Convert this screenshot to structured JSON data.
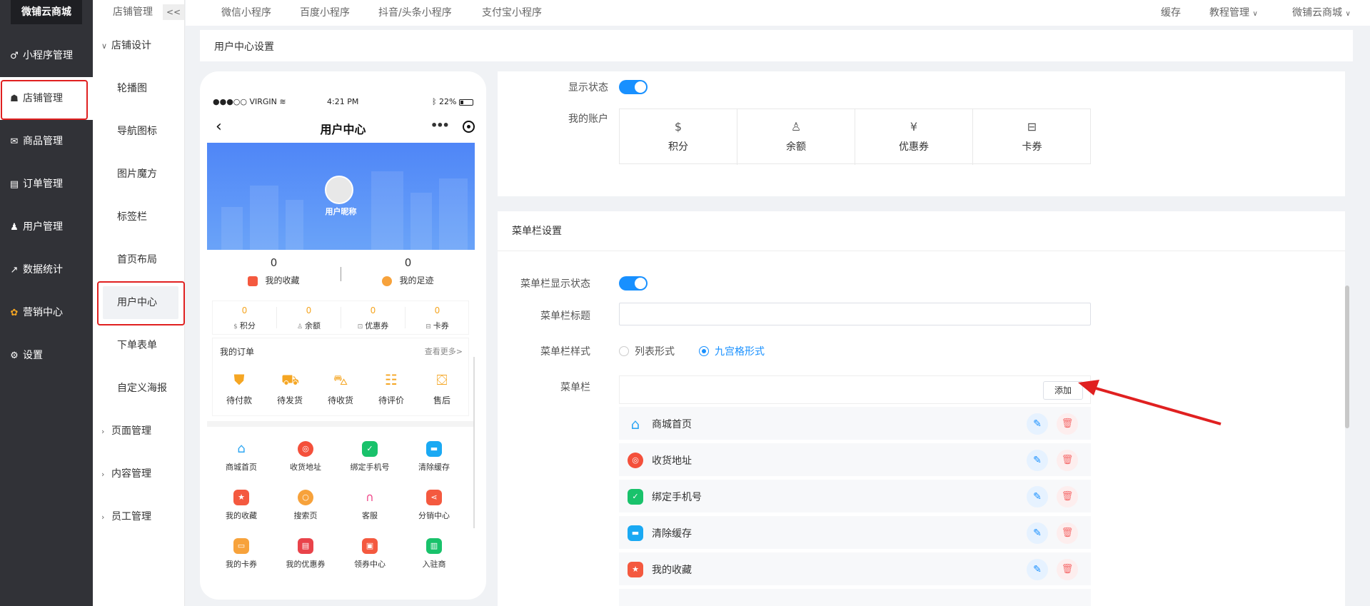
{
  "app": {
    "logo": "微铺云商城",
    "back_glyph": "<<"
  },
  "left_nav": [
    {
      "label": "小程序管理",
      "icon": "link-icon"
    },
    {
      "label": "店铺管理",
      "icon": "store-icon"
    },
    {
      "label": "商品管理",
      "icon": "bag-icon"
    },
    {
      "label": "订单管理",
      "icon": "order-icon"
    },
    {
      "label": "用户管理",
      "icon": "user-icon"
    },
    {
      "label": "数据统计",
      "icon": "chart-icon"
    },
    {
      "label": "营销中心",
      "icon": "marketing-icon"
    },
    {
      "label": "设置",
      "icon": "gear-icon"
    }
  ],
  "sub_nav": {
    "header": "店铺管理",
    "group_store_design": "店铺设计",
    "items": [
      "轮播图",
      "导航图标",
      "图片魔方",
      "标签栏",
      "首页布局",
      "用户中心",
      "下单表单",
      "自定义海报"
    ],
    "groups": [
      "页面管理",
      "内容管理",
      "员工管理"
    ]
  },
  "topbar": {
    "tabs": [
      "微信小程序",
      "百度小程序",
      "抖音/头条小程序",
      "支付宝小程序"
    ],
    "cache": "缓存",
    "tutorial": "教程管理",
    "account": "微铺云商城"
  },
  "panel_title": "用户中心设置",
  "phone": {
    "carrier": "●●●○○ VIRGIN",
    "time": "4:21 PM",
    "battery": "22%",
    "title": "用户中心",
    "nickname": "用户昵称",
    "fav_count": "0",
    "fav_label": "我的收藏",
    "foot_count": "0",
    "foot_label": "我的足迹",
    "accounts": [
      {
        "value": "0",
        "label": "积分"
      },
      {
        "value": "0",
        "label": "余额"
      },
      {
        "value": "0",
        "label": "优惠券"
      },
      {
        "value": "0",
        "label": "卡券"
      }
    ],
    "orders_title": "我的订单",
    "orders_more": "查看更多>",
    "orders": [
      "待付款",
      "待发货",
      "待收货",
      "待评价",
      "售后"
    ],
    "grid": [
      {
        "label": "商城首页",
        "color": "#ffffff"
      },
      {
        "label": "收货地址",
        "color": "#f4503b"
      },
      {
        "label": "绑定手机号",
        "color": "#19c26b"
      },
      {
        "label": "清除缓存",
        "color": "#1aa9f3"
      },
      {
        "label": "我的收藏",
        "color": "#f4593f"
      },
      {
        "label": "搜索页",
        "color": "#f7a23b"
      },
      {
        "label": "客服",
        "color": "#f0488a"
      },
      {
        "label": "分销中心",
        "color": "#f4593f"
      },
      {
        "label": "我的卡券",
        "color": "#f7a23b"
      },
      {
        "label": "我的优惠券",
        "color": "#e9434a"
      },
      {
        "label": "领券中心",
        "color": "#f4593f"
      },
      {
        "label": "入驻商",
        "color": "#19c26b"
      }
    ]
  },
  "settings": {
    "display_status_label": "显示状态",
    "my_account_label": "我的账户",
    "account_items": [
      "积分",
      "余额",
      "优惠券",
      "卡券"
    ],
    "menu_section_title": "菜单栏设置",
    "menu_display_label": "菜单栏显示状态",
    "menu_title_label": "菜单栏标题",
    "menu_title_value": "",
    "menu_style_label": "菜单栏样式",
    "style_list": "列表形式",
    "style_grid": "九宫格形式",
    "menu_label": "菜单栏",
    "add_button": "添加",
    "menu_items": [
      {
        "label": "商城首页",
        "color": "#ffffff"
      },
      {
        "label": "收货地址",
        "color": "#f4503b"
      },
      {
        "label": "绑定手机号",
        "color": "#19c26b"
      },
      {
        "label": "清除缓存",
        "color": "#1aa9f3"
      },
      {
        "label": "我的收藏",
        "color": "#f4593f"
      }
    ]
  },
  "colors": {
    "accent": "#1890ff",
    "danger": "#f56c6c",
    "highlight_border": "#e02020"
  }
}
